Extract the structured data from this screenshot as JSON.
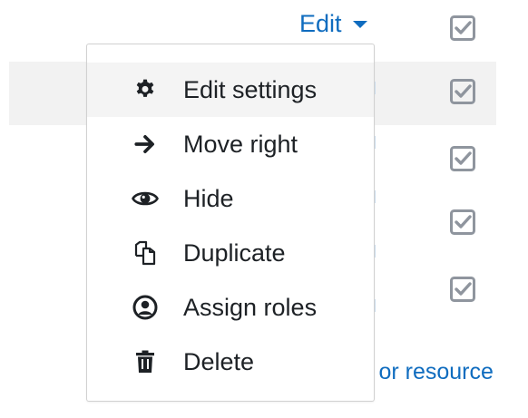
{
  "edit_toggle": {
    "label": "Edit"
  },
  "menu": {
    "items": [
      {
        "label": "Edit settings",
        "icon": "gear-icon"
      },
      {
        "label": "Move right",
        "icon": "arrow-right-icon"
      },
      {
        "label": "Hide",
        "icon": "eye-icon"
      },
      {
        "label": "Duplicate",
        "icon": "duplicate-icon"
      },
      {
        "label": "Assign roles",
        "icon": "user-circle-icon"
      },
      {
        "label": "Delete",
        "icon": "trash-icon"
      }
    ]
  },
  "background_link": {
    "text": "y or resource"
  },
  "checkboxes": {
    "count": 5,
    "state": "checked"
  },
  "colors": {
    "link": "#0f6cbf",
    "text": "#1d2125",
    "checkbox": "#8f959e",
    "row_highlight": "#f2f2f2"
  }
}
